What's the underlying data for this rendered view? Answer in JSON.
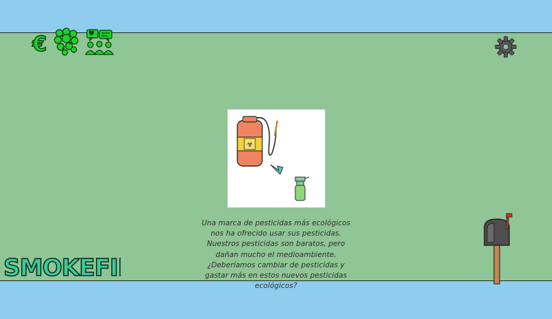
{
  "game": {
    "logo_text": "SMOKEFIELD",
    "currency_symbol": "€"
  },
  "hud": {
    "money_icon": "euro-icon",
    "pollution_icon": "smoke-cloud-icon",
    "opinion_icon": "people-opinion-icon",
    "settings_icon": "gear-icon"
  },
  "event": {
    "image_icon": "pesticide-sprayer-to-spray-bottle",
    "text": "Una marca de pesticidas más ecológicos nos ha ofrecido usar sus pesticidas. Nuestros pesticidas son baratos, pero dañan mucho el medioambiente.  ¿Deberíamos cambiar de pesticidas y gastar más en estos nuevos pesticidas ecológicos?"
  },
  "colors": {
    "sky": "#8fcdee",
    "field": "#90c596",
    "hud_green": "#1fd12c",
    "logo_fill": "#3dcb9a"
  }
}
